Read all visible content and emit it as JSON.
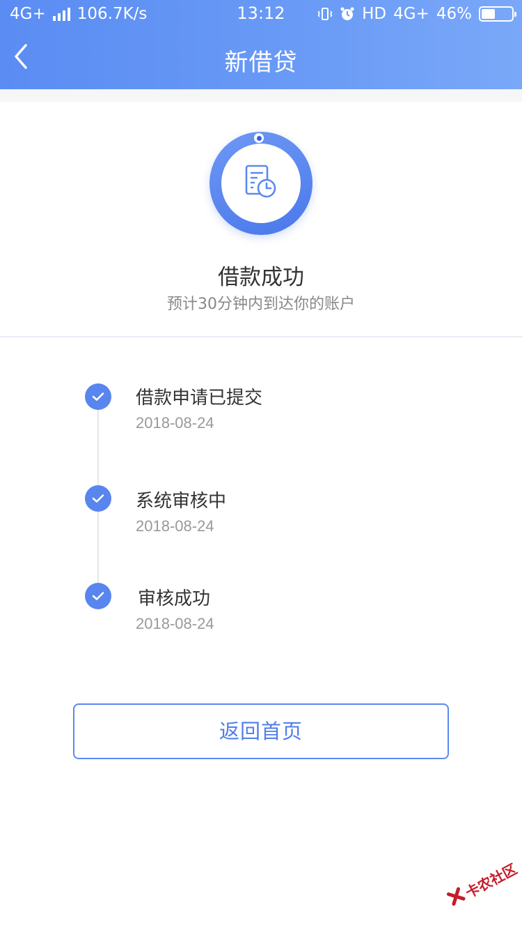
{
  "status_bar": {
    "network_type": "4G+",
    "speed": "106.7K/s",
    "time": "13:12",
    "hd_label": "HD",
    "network_type_right": "4G+",
    "battery": "46%",
    "battery_level": 0.46,
    "icons": [
      "signal-bars-icon",
      "vibrate-icon",
      "alarm-clock-icon",
      "battery-icon"
    ]
  },
  "nav": {
    "title": "新借贷",
    "back_icon": "chevron-left-icon"
  },
  "result": {
    "icon": "document-clock-icon",
    "title": "借款成功",
    "subtitle": "预计30分钟内到达你的账户"
  },
  "timeline": {
    "steps": [
      {
        "title": "借款申请已提交",
        "date": "2018-08-24"
      },
      {
        "title": "系统审核中",
        "date": "2018-08-24"
      },
      {
        "title": "审核成功",
        "date": "2018-08-24"
      }
    ]
  },
  "actions": {
    "home_label": "返回首页"
  },
  "watermark": {
    "text": "卡农社区"
  },
  "colors": {
    "accent": "#5885ee",
    "header_gradient_start": "#5a8cf3",
    "header_gradient_end": "#7aa8f8",
    "text_primary": "#333333",
    "text_secondary": "#999999",
    "watermark": "#c51c2a"
  }
}
